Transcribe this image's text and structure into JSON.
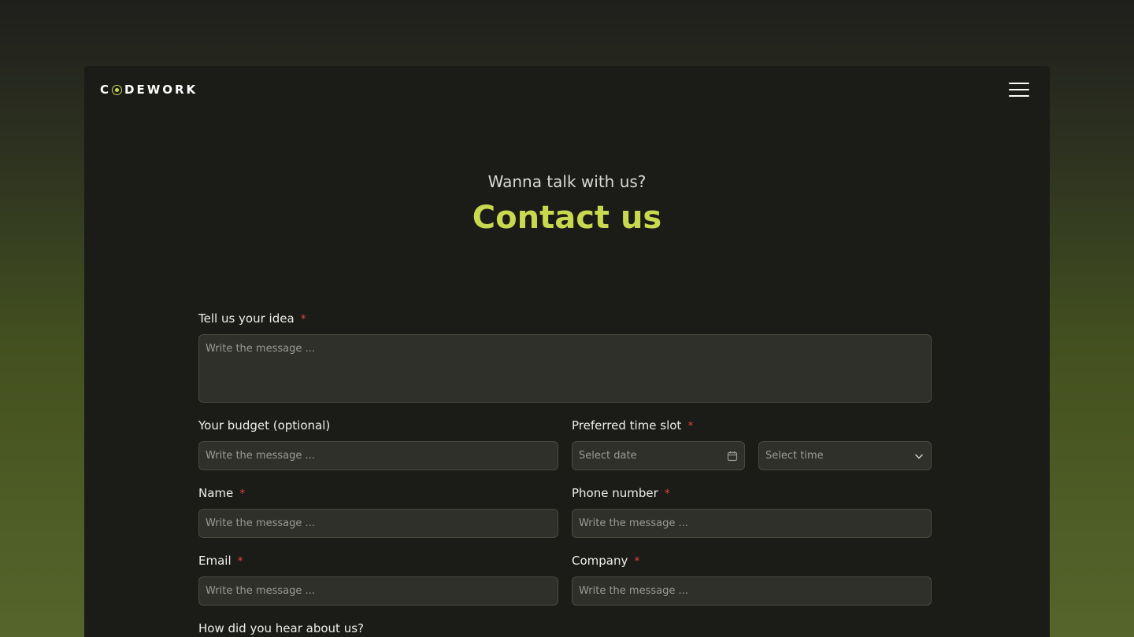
{
  "header": {
    "logo_text_start": "C",
    "logo_text_end": "DEWORK",
    "menu_icon": "hamburger-menu-icon"
  },
  "hero": {
    "eyebrow": "Wanna talk with us?",
    "title": "Contact us"
  },
  "colors": {
    "accent": "#c9d94f",
    "required": "#d9443a",
    "card_bg": "#1b1b18",
    "input_bg": "#30302b"
  },
  "form": {
    "idea": {
      "label": "Tell us your idea",
      "required": "*",
      "placeholder": "Write the message ..."
    },
    "budget": {
      "label": "Your budget (optional)",
      "placeholder": "Write the message ..."
    },
    "time_slot": {
      "label": "Preferred time slot",
      "required": "*",
      "date_placeholder": "Select date",
      "date_icon": "calendar-icon",
      "time_placeholder": "Select time",
      "time_icon": "chevron-down-icon"
    },
    "name": {
      "label": "Name",
      "required": "*",
      "placeholder": "Write the message ..."
    },
    "phone": {
      "label": "Phone number",
      "required": "*",
      "placeholder": "Write the message ..."
    },
    "email": {
      "label": "Email",
      "required": "*",
      "placeholder": "Write the message ..."
    },
    "company": {
      "label": "Company",
      "required": "*",
      "placeholder": "Write the message ..."
    },
    "referral": {
      "label": "How did you hear about us?"
    }
  }
}
